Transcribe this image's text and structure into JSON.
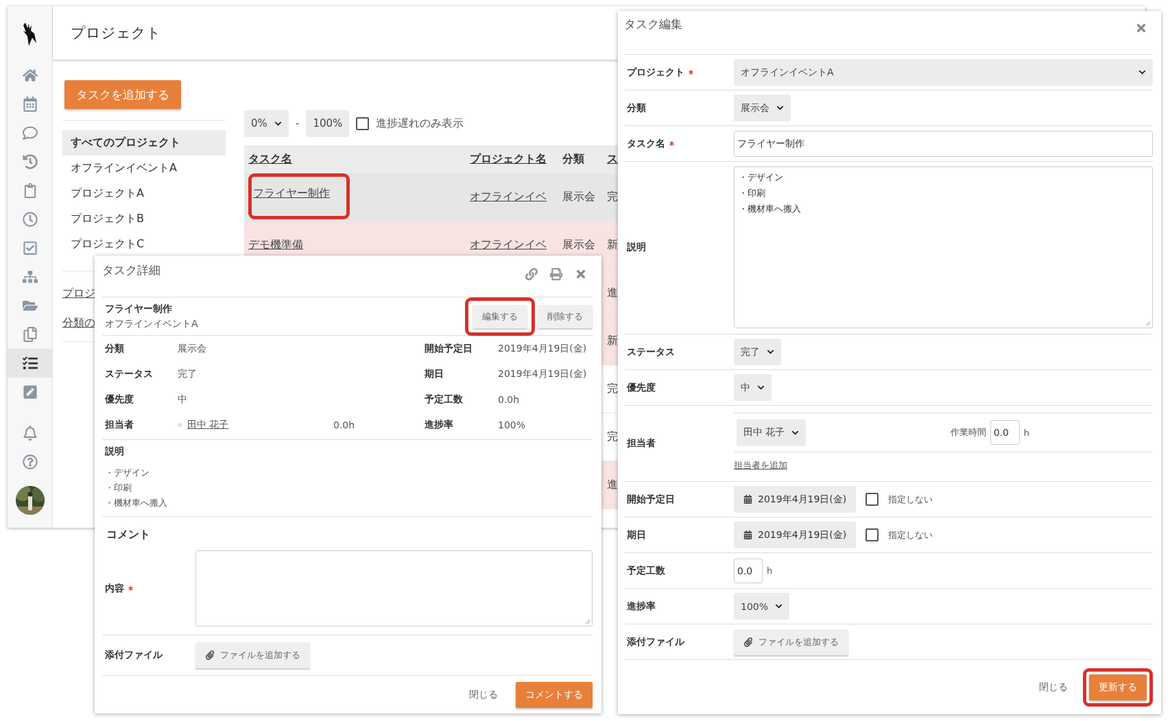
{
  "app": {
    "title": "プロジェクト",
    "sidebar": {
      "main": [
        {
          "selected": false
        },
        {
          "selected": false
        },
        {
          "selected": false
        },
        {
          "selected": false
        },
        {
          "selected": false
        },
        {
          "selected": false
        },
        {
          "selected": false
        },
        {
          "selected": false
        },
        {
          "selected": false
        },
        {
          "selected": false
        },
        {
          "selected": true
        },
        {
          "selected": false
        }
      ],
      "bottom": [
        {
          "selected": false
        },
        {
          "selected": false
        }
      ]
    },
    "add_task_button": "タスクを追加する",
    "project_list": {
      "items": [
        {
          "label": "すべてのプロジェクト",
          "selected": true
        },
        {
          "label": "オフラインイベントA",
          "selected": false
        },
        {
          "label": "プロジェクトA",
          "selected": false
        },
        {
          "label": "プロジェクトB",
          "selected": false
        },
        {
          "label": "プロジェクトC",
          "selected": false
        }
      ],
      "links": [
        "プロジ",
        "分類の"
      ]
    },
    "filter": {
      "min": "0%",
      "separator": "-",
      "max": "100%",
      "delayed_only": {
        "label": "進捗遅れのみ表示",
        "checked": false
      }
    },
    "table": {
      "columns": [
        {
          "label": "タスク名",
          "sortable": true
        },
        {
          "label": "プロジェクト名",
          "sortable": true
        },
        {
          "label": "分類",
          "sortable": false
        },
        {
          "label": "ス",
          "sortable": true
        }
      ],
      "rows": [
        {
          "task": "フライヤー制作",
          "project": "オフラインイベ",
          "category": "展示会",
          "status": "完",
          "delayed": false,
          "selected": true,
          "highlighted": true
        },
        {
          "task": "デモ機準備",
          "project": "オフラインイベ",
          "category": "展示会",
          "status": "新",
          "delayed": true,
          "selected": false,
          "highlighted": false
        },
        {
          "status": "進",
          "delayed": true,
          "selected": false
        },
        {
          "status": "新",
          "delayed": true,
          "selected": false
        },
        {
          "status": "完",
          "delayed": false,
          "selected": false
        },
        {
          "status": "完",
          "delayed": false,
          "selected": false
        },
        {
          "status": "進",
          "delayed": true,
          "selected": false
        }
      ]
    }
  },
  "detail_dialog": {
    "title": "タスク詳細",
    "task_name": "フライヤー制作",
    "project": "オフラインイベントA",
    "buttons": [
      {
        "label": "編集する",
        "highlighted": true
      },
      {
        "label": "削除する",
        "highlighted": false
      }
    ],
    "fields_left": [
      {
        "kind": "text",
        "label": "分類",
        "value": "展示会"
      },
      {
        "kind": "text",
        "label": "ステータス",
        "value": "完了"
      },
      {
        "kind": "text",
        "label": "優先度",
        "value": "中"
      },
      {
        "kind": "assignee",
        "label": "担当者",
        "value": "田中 花子",
        "hours": "0.0h"
      }
    ],
    "fields_right": [
      {
        "label": "開始予定日",
        "value": "2019年4月19日(金)"
      },
      {
        "label": "期日",
        "value": "2019年4月19日(金)"
      },
      {
        "label": "予定工数",
        "value": "0.0h"
      },
      {
        "label": "進捗率",
        "value": "100%"
      }
    ],
    "description": {
      "label": "説明",
      "lines": [
        "・デザイン",
        "・印刷",
        "・機材車へ搬入"
      ]
    },
    "comment": {
      "heading": "コメント",
      "content_label": "内容",
      "required": true,
      "attachment_label": "添付ファイル",
      "attach_button": "ファイルを追加する"
    },
    "footer": {
      "close": "閉じる",
      "submit": {
        "label": "コメントする",
        "highlighted": false
      }
    }
  },
  "edit_dialog": {
    "title": "タスク編集",
    "rows": [
      {
        "kind": "wide_select",
        "label": "プロジェクト",
        "required": true,
        "value": "オフラインイベントA"
      },
      {
        "kind": "select",
        "label": "分類",
        "required": false,
        "value": "展示会"
      },
      {
        "kind": "text",
        "label": "タスク名",
        "required": true,
        "value": "フライヤー制作"
      },
      {
        "kind": "textarea",
        "label": "説明",
        "required": false,
        "lines": [
          "・デザイン",
          "・印刷",
          "・機材車へ搬入"
        ]
      },
      {
        "kind": "select",
        "label": "ステータス",
        "required": false,
        "value": "完了"
      },
      {
        "kind": "select",
        "label": "優先度",
        "required": false,
        "value": "中"
      },
      {
        "kind": "assignee",
        "label": "担当者",
        "required": false,
        "value": "田中 花子",
        "hours_label": "作業時間",
        "hours": "0.0",
        "unit": "h",
        "add_link": "担当者を追加"
      },
      {
        "kind": "date",
        "label": "開始予定日",
        "required": false,
        "value": "2019年4月19日(金)",
        "unset": {
          "label": "指定しない",
          "checked": false
        }
      },
      {
        "kind": "date",
        "label": "期日",
        "required": false,
        "value": "2019年4月19日(金)",
        "unset": {
          "label": "指定しない",
          "checked": false
        }
      },
      {
        "kind": "number",
        "label": "予定工数",
        "required": false,
        "value": "0.0",
        "unit": "h"
      },
      {
        "kind": "select",
        "label": "進捗率",
        "required": false,
        "value": "100%"
      },
      {
        "kind": "file",
        "label": "添付ファイル",
        "required": false,
        "button": "ファイルを追加する"
      }
    ],
    "footer": {
      "close": "閉じる",
      "submit": {
        "label": "更新する",
        "highlighted": true
      }
    }
  }
}
